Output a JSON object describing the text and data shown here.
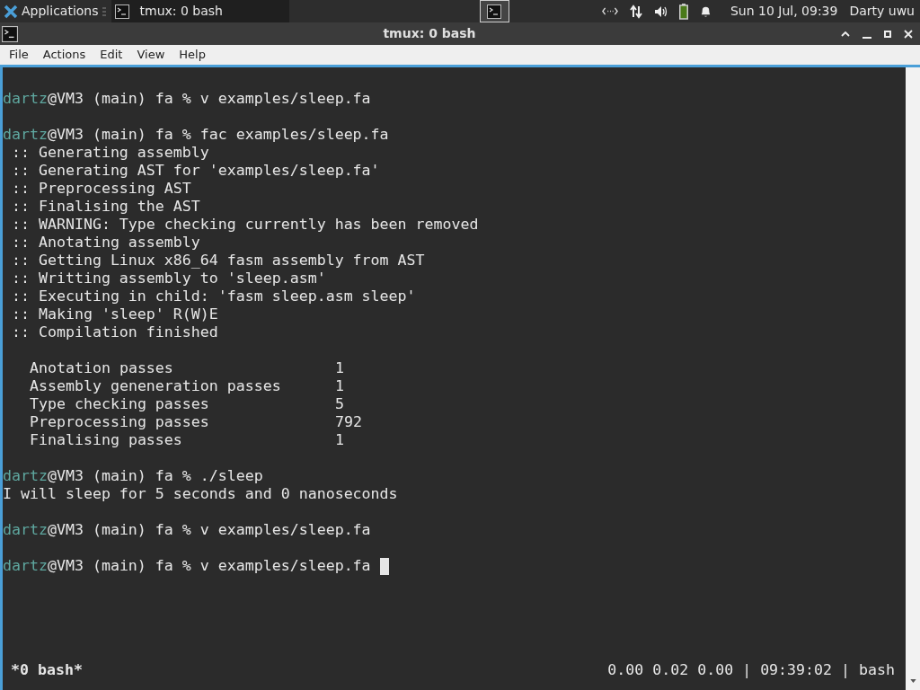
{
  "panel": {
    "menu_label": "Applications",
    "tasks": [
      {
        "title": "tmux: 0 bash",
        "selected": true
      }
    ],
    "workspaces": [
      {
        "selected": true
      }
    ],
    "clock": "Sun 10 Jul, 09:39",
    "user": "Darty uwu"
  },
  "window": {
    "title": "tmux: 0 bash"
  },
  "menu": [
    "File",
    "Actions",
    "Edit",
    "View",
    "Help"
  ],
  "terminal": {
    "lines": [
      {
        "kind": "blank"
      },
      {
        "kind": "prompt",
        "user": "dartz",
        "rest": "@VM3 (main) fa % v examples/sleep.fa"
      },
      {
        "kind": "blank"
      },
      {
        "kind": "prompt",
        "user": "dartz",
        "rest": "@VM3 (main) fa % fac examples/sleep.fa"
      },
      {
        "kind": "output",
        "text": " :: Generating assembly"
      },
      {
        "kind": "output",
        "text": " :: Generating AST for 'examples/sleep.fa'"
      },
      {
        "kind": "output",
        "text": " :: Preprocessing AST"
      },
      {
        "kind": "output",
        "text": " :: Finalising the AST"
      },
      {
        "kind": "output",
        "text": " :: WARNING: Type checking currently has been removed"
      },
      {
        "kind": "output",
        "text": " :: Anotating assembly"
      },
      {
        "kind": "output",
        "text": " :: Getting Linux x86_64 fasm assembly from AST"
      },
      {
        "kind": "output",
        "text": " :: Writting assembly to 'sleep.asm'"
      },
      {
        "kind": "output",
        "text": " :: Executing in child: 'fasm sleep.asm sleep'"
      },
      {
        "kind": "output",
        "text": " :: Making 'sleep' R(W)E"
      },
      {
        "kind": "output",
        "text": " :: Compilation finished"
      },
      {
        "kind": "blank"
      },
      {
        "kind": "stat",
        "label": "Anotation passes",
        "value": "1"
      },
      {
        "kind": "stat",
        "label": "Assembly geneneration passes",
        "value": "1"
      },
      {
        "kind": "stat",
        "label": "Type checking passes",
        "value": "5"
      },
      {
        "kind": "stat",
        "label": "Preprocessing passes",
        "value": "792"
      },
      {
        "kind": "stat",
        "label": "Finalising passes",
        "value": "1"
      },
      {
        "kind": "blank"
      },
      {
        "kind": "prompt",
        "user": "dartz",
        "rest": "@VM3 (main) fa % ./sleep"
      },
      {
        "kind": "output",
        "text": "I will sleep for 5 seconds and 0 nanoseconds"
      },
      {
        "kind": "blank"
      },
      {
        "kind": "prompt",
        "user": "dartz",
        "rest": "@VM3 (main) fa % v examples/sleep.fa"
      },
      {
        "kind": "blank"
      },
      {
        "kind": "prompt",
        "user": "dartz",
        "rest": "@VM3 (main) fa % v examples/sleep.fa",
        "cursor": true
      }
    ]
  },
  "tmux_status": {
    "window": "*0 bash*",
    "right": "0.00 0.02 0.00 | 09:39:02 | bash"
  }
}
